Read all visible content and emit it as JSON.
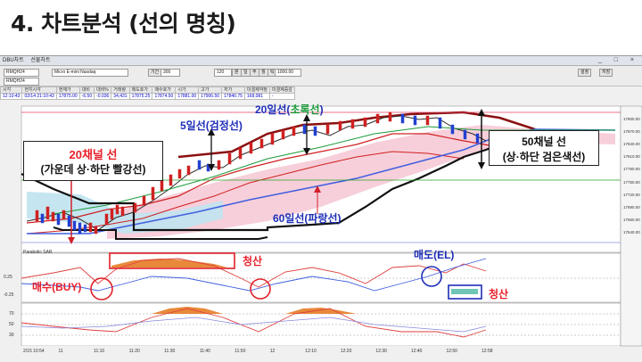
{
  "slide": {
    "title": "4. 차트분석 (선의 명칭)"
  },
  "app": {
    "menu": [
      "DBU차트",
      "선물차트"
    ],
    "window_controls": [
      "_",
      "□",
      "×"
    ],
    "symbol": "RMQH24",
    "instrument": "Micro E-mini Nasdaq",
    "interval_label": "기간",
    "interval_value": "300",
    "count_value": "120",
    "timeframe_buttons": [
      "분",
      "일",
      "주",
      "월",
      "틱"
    ],
    "display_value": "1000.00",
    "right_buttons": [
      "설정",
      "저장"
    ],
    "info_headers": [
      "시각",
      "현지시각",
      "현재가",
      "대비",
      "대비%",
      "거래량",
      "매도호가",
      "매수호가",
      "시가",
      "고가",
      "저가",
      "미결제약정",
      "미결제증감"
    ],
    "info_values": [
      "12:10:43",
      "02/14 21:10:43",
      "17875.00",
      "-6.50",
      "-0.036",
      "34,431",
      "17875.25",
      "17874.50",
      "17881.00",
      "17906.50",
      "17840.75",
      "168,081",
      "-"
    ]
  },
  "price_axis": [
    "17900.00",
    "17870.00",
    "17840.00",
    "17810.00",
    "17780.00",
    "17750.00",
    "17720.00",
    "17690.00",
    "17660.00",
    "17640.00"
  ],
  "time_axis": [
    "2/15 10:54",
    "11",
    "11:10",
    "11:20",
    "11:30",
    "11:40",
    "11:50",
    "12",
    "12:10",
    "12:20",
    "12:30",
    "12:40",
    "12:50",
    "12:58"
  ],
  "indicator_label": "Parabolic SAR",
  "osc_axis_1": [
    "0.25",
    "-0.25"
  ],
  "osc_axis_2": [
    "70",
    "50",
    "30"
  ],
  "annotations": {
    "ch20_title": "20채널 선",
    "ch20_desc": "(가운데 상·하단 빨강선)",
    "ma5": "5일선(검정선)",
    "ma20_prefix": "20일선(",
    "ma20_word": "초록선",
    "ma20_suffix": ")",
    "ch50_title": "50채널 선",
    "ch50_desc": "(상·하단 검은색선)",
    "ma60": "60일선(파랑선)",
    "settle_1": "청산",
    "buy": "매수(BUY)",
    "sell": "매도(EL)",
    "settle_2": "청산"
  },
  "colors": {
    "accent_red": "#e8202a",
    "accent_blue": "#1f2fb8",
    "ma20_green": "#1b9a3a",
    "ch20_red": "#8b1010",
    "ma60_blue": "#4060e0",
    "osc_orange": "#e8893a"
  }
}
